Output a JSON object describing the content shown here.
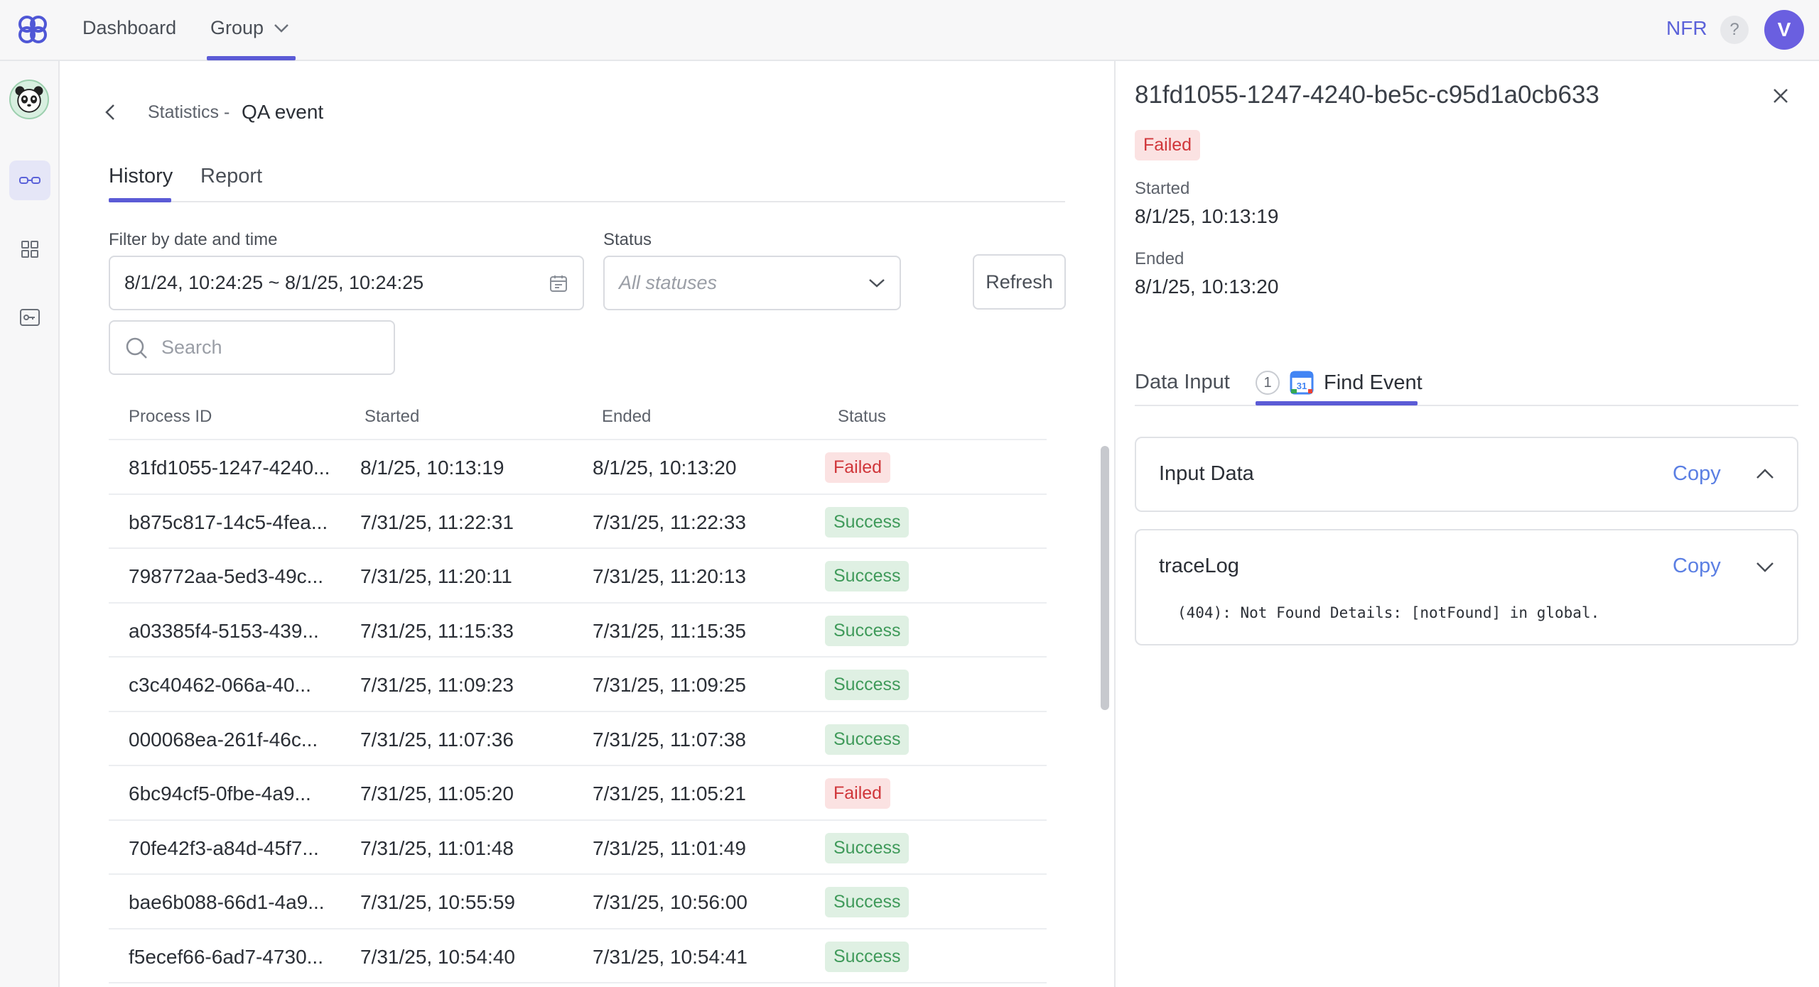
{
  "topbar": {
    "nav": [
      "Dashboard",
      "Group"
    ],
    "org": "NFR",
    "help": "?",
    "user_initial": "V"
  },
  "breadcrumb": {
    "parent": "Statistics -",
    "title": "QA event"
  },
  "tabs": [
    "History",
    "Report"
  ],
  "filters": {
    "date_label": "Filter by date and time",
    "date_value": "8/1/24, 10:24:25 ~ 8/1/25, 10:24:25",
    "status_label": "Status",
    "status_placeholder": "All statuses",
    "refresh": "Refresh",
    "search_placeholder": "Search"
  },
  "table": {
    "headers": [
      "Process ID",
      "Started",
      "Ended",
      "Status"
    ],
    "rows": [
      {
        "id": "81fd1055-1247-4240...",
        "started": "8/1/25, 10:13:19",
        "ended": "8/1/25, 10:13:20",
        "status": "Failed"
      },
      {
        "id": "b875c817-14c5-4fea...",
        "started": "7/31/25, 11:22:31",
        "ended": "7/31/25, 11:22:33",
        "status": "Success"
      },
      {
        "id": "798772aa-5ed3-49c...",
        "started": "7/31/25, 11:20:11",
        "ended": "7/31/25, 11:20:13",
        "status": "Success"
      },
      {
        "id": "a03385f4-5153-439...",
        "started": "7/31/25, 11:15:33",
        "ended": "7/31/25, 11:15:35",
        "status": "Success"
      },
      {
        "id": "c3c40462-066a-40...",
        "started": "7/31/25, 11:09:23",
        "ended": "7/31/25, 11:09:25",
        "status": "Success"
      },
      {
        "id": "000068ea-261f-46c...",
        "started": "7/31/25, 11:07:36",
        "ended": "7/31/25, 11:07:38",
        "status": "Success"
      },
      {
        "id": "6bc94cf5-0fbe-4a9...",
        "started": "7/31/25, 11:05:20",
        "ended": "7/31/25, 11:05:21",
        "status": "Failed"
      },
      {
        "id": "70fe42f3-a84d-45f7...",
        "started": "7/31/25, 11:01:48",
        "ended": "7/31/25, 11:01:49",
        "status": "Success"
      },
      {
        "id": "bae6b088-66d1-4a9...",
        "started": "7/31/25, 10:55:59",
        "ended": "7/31/25, 10:56:00",
        "status": "Success"
      },
      {
        "id": "f5ecef66-6ad7-4730...",
        "started": "7/31/25, 10:54:40",
        "ended": "7/31/25, 10:54:41",
        "status": "Success"
      }
    ]
  },
  "panel": {
    "title": "81fd1055-1247-4240-be5c-c95d1a0cb633",
    "status": "Failed",
    "started_label": "Started",
    "started_value": "8/1/25, 10:13:19",
    "ended_label": "Ended",
    "ended_value": "8/1/25, 10:13:20",
    "tabs": {
      "data_input": "Data Input",
      "step_number": "1",
      "find_event": "Find Event",
      "find_event_icon": "calendar-31-icon"
    },
    "cards": [
      {
        "title": "Input Data",
        "copy": "Copy",
        "expanded": false
      },
      {
        "title": "traceLog",
        "copy": "Copy",
        "expanded": true,
        "log": "(404): Not Found Details: [notFound] in global."
      }
    ]
  },
  "colors": {
    "accent": "#5b5bd6",
    "link": "#5b7fe3",
    "failed_bg": "#fbe2e2",
    "failed_text": "#d0363a",
    "success_bg": "#dff0e3",
    "success_text": "#3f9a5a"
  }
}
